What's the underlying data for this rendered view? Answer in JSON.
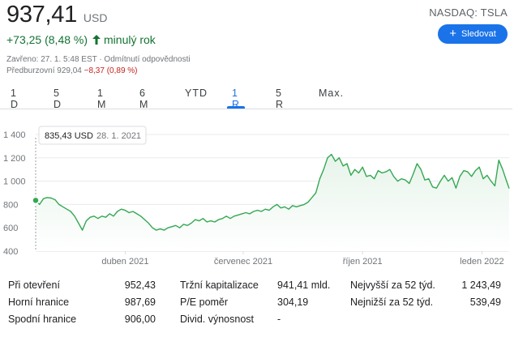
{
  "quote": {
    "price": "937,41",
    "currency": "USD",
    "change": "+73,25 (8,48 %)",
    "period": "minulý rok",
    "ticker": "NASDAQ: TSLA",
    "follow_label": "Sledovat",
    "closed_text": "Zavřeno: 27. 1. 5:48 EST · Odmítnutí odpovědnosti",
    "premarket_label": "Předburzovní 929,04",
    "premarket_change": "−8,37 (0,89 %)",
    "positive_color": "#137333",
    "negative_color": "#c5221f",
    "accent_color": "#1a73e8"
  },
  "tabs": [
    {
      "label": "1 D",
      "active": false
    },
    {
      "label": "5 D",
      "active": false
    },
    {
      "label": "1 M",
      "active": false
    },
    {
      "label": "6 M",
      "active": false
    },
    {
      "label": "YTD",
      "active": false
    },
    {
      "label": "1 R",
      "active": true
    },
    {
      "label": "5 R",
      "active": false
    },
    {
      "label": "Max.",
      "active": false
    }
  ],
  "chart_data": {
    "type": "area",
    "x_tick_labels": [
      "duben 2021",
      "červenec 2021",
      "říjen 2021",
      "leden 2022"
    ],
    "y_ticks": [
      400,
      600,
      800,
      1000,
      1200,
      1400
    ],
    "y_tick_labels": [
      "400",
      "600",
      "800",
      "1 000",
      "1 200",
      "1 400"
    ],
    "ylim": [
      400,
      1400
    ],
    "x_range_days": [
      0,
      365
    ],
    "grid": true,
    "line_color": "#34a853",
    "fill_color": "#e6f4ea",
    "tooltip": {
      "value": "835,43 USD",
      "date": "28. 1. 2021"
    },
    "series": [
      {
        "x": [
          0,
          3,
          6,
          9,
          12,
          15,
          18,
          21,
          24,
          27,
          30,
          33,
          36,
          39,
          42,
          45,
          48,
          51,
          54,
          57,
          60,
          63,
          66,
          69,
          72,
          75,
          78,
          81,
          84,
          87,
          90,
          93,
          96,
          99,
          102,
          105,
          108,
          111,
          114,
          117,
          120,
          123,
          126,
          129,
          132,
          135,
          138,
          141,
          144,
          147,
          150,
          153,
          156,
          159,
          162,
          165,
          168,
          171,
          174,
          177,
          180,
          183,
          186,
          189,
          192,
          195,
          198,
          201,
          204,
          207,
          210,
          213,
          216,
          219,
          222,
          225,
          228,
          231,
          234,
          237,
          240,
          243,
          246,
          249,
          252,
          255,
          258,
          261,
          264,
          267,
          270,
          273,
          276,
          279,
          282,
          285,
          288,
          291,
          294,
          297,
          300,
          303,
          306,
          309,
          312,
          315,
          318,
          321,
          324,
          327,
          330,
          333,
          336,
          339,
          342,
          345,
          348,
          351,
          354,
          357,
          360,
          363,
          365
        ],
        "values": [
          835,
          800,
          850,
          860,
          855,
          840,
          800,
          780,
          760,
          740,
          700,
          640,
          580,
          660,
          690,
          700,
          680,
          700,
          690,
          720,
          700,
          740,
          760,
          750,
          730,
          740,
          720,
          700,
          670,
          640,
          600,
          580,
          590,
          580,
          600,
          610,
          620,
          600,
          630,
          620,
          640,
          670,
          660,
          680,
          650,
          660,
          650,
          670,
          680,
          700,
          680,
          700,
          710,
          720,
          730,
          720,
          740,
          750,
          740,
          760,
          750,
          780,
          800,
          770,
          780,
          760,
          790,
          780,
          790,
          800,
          820,
          860,
          900,
          1020,
          1100,
          1200,
          1230,
          1170,
          1200,
          1130,
          1150,
          1050,
          1100,
          1070,
          1120,
          1040,
          1050,
          1020,
          1090,
          1070,
          1080,
          1100,
          1040,
          1000,
          1020,
          1010,
          980,
          1060,
          1150,
          1100,
          1010,
          1020,
          950,
          940,
          1000,
          1050,
          1000,
          1030,
          940,
          1040,
          1090,
          1080,
          1040,
          1090,
          1120,
          1020,
          1050,
          1000,
          960,
          1180,
          1100,
          1000,
          937
        ]
      }
    ]
  },
  "stats": {
    "rows": [
      [
        {
          "label": "Při otevření",
          "value": "952,43"
        },
        {
          "label": "Tržní kapitalizace",
          "value": "941,41 mld."
        },
        {
          "label": "Nejvyšší za 52 týd.",
          "value": "1 243,49"
        }
      ],
      [
        {
          "label": "Horní hranice",
          "value": "987,69"
        },
        {
          "label": "P/E poměr",
          "value": "304,19"
        },
        {
          "label": "Nejnižší za 52 týd.",
          "value": "539,49"
        }
      ],
      [
        {
          "label": "Spodní hranice",
          "value": "906,00"
        },
        {
          "label": "Divid. výnosnost",
          "value": "-"
        },
        {
          "label": "",
          "value": ""
        }
      ]
    ]
  }
}
